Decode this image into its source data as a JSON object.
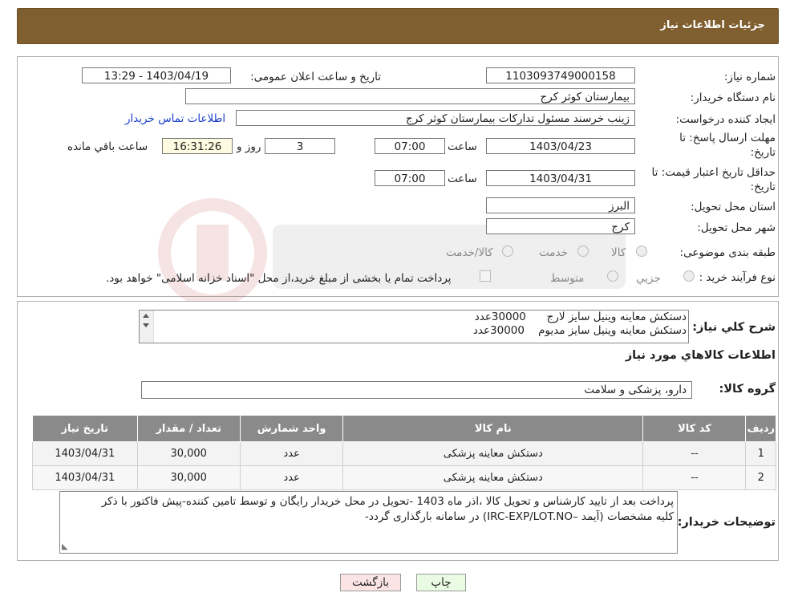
{
  "header": {
    "title": "جزئیات اطلاعات نیاز"
  },
  "form": {
    "need_number_label": "شماره نیاز:",
    "need_number": "1103093749000158",
    "announce_label": "تاریخ و ساعت اعلان عمومی:",
    "announce_value": "1403/04/19 - 13:29",
    "buyer_org_label": "نام دستگاه خریدار:",
    "buyer_org": "بیمارستان کوثر کرج",
    "creator_label": "ایجاد کننده درخواست:",
    "creator": "زینب خرسند مسئول تدارکات بیمارستان کوثر کرج",
    "contact_link": "اطلاعات تماس خریدار",
    "deadline_label_1": "مهلت ارسال پاسخ: تا",
    "deadline_label_2": "تاریخ:",
    "deadline_date": "1403/04/23",
    "time_word": "ساعت",
    "deadline_time": "07:00",
    "days_value": "3",
    "day_word": "روز و",
    "remaining_time": "16:31:26",
    "remaining_label": "ساعت باقي مانده",
    "validity_label_1": "حداقل تاریخ اعتبار قیمت: تا",
    "validity_label_2": "تاریخ:",
    "validity_date": "1403/04/31",
    "validity_time": "07:00",
    "province_label": "استان محل تحویل:",
    "province": "البرز",
    "city_label": "شهر محل تحویل:",
    "city": "کرج",
    "category_label": "طبقه بندی موضوعی:",
    "category_options": [
      "کالا",
      "خدمت",
      "کالا/خدمت"
    ],
    "purchase_type_label": "نوع فرآیند خرید :",
    "purchase_options": [
      "جزیي",
      "متوسط"
    ],
    "payment_note": "پرداخت تمام یا بخشی از مبلغ خرید،از محل \"اسناد خزانه اسلامی\" خواهد بود."
  },
  "summary": {
    "label": "شرح کلي نیاز:",
    "lines": [
      "دستکش معاینه وینیل سایز لارج      30000عدد",
      "دستکش معاینه وینیل سایز مدیوم    30000عدد"
    ]
  },
  "goods": {
    "section_title": "اطلاعات کالاهاي مورد نیاز",
    "group_label": "گروه کالا:",
    "group_value": "دارو، پزشکی و سلامت",
    "columns": [
      "ردیف",
      "کد کالا",
      "نام کالا",
      "واحد شمارش",
      "تعداد / مقدار",
      "تاریخ نیاز"
    ],
    "rows": [
      [
        "1",
        "--",
        "دستکش معاینه پزشکی",
        "عدد",
        "30,000",
        "1403/04/31"
      ],
      [
        "2",
        "--",
        "دستکش معاینه پزشکی",
        "عدد",
        "30,000",
        "1403/04/31"
      ]
    ]
  },
  "notes": {
    "label": "توضیحات خریدار:",
    "line1": "پرداخت بعد از تایید کارشناس و تحویل کالا ،اذر ماه 1403 -تحویل در محل خریدار رایگان و توسط تامین کننده-پیش فاکتور با ذکر",
    "line2": "کلیه مشخصات (آیمد –IRC-EXP/LOT.NO) در سامانه بارگذاری گردد-"
  },
  "buttons": {
    "print": "چاپ",
    "back": "بازگشت"
  },
  "colors": {
    "header_bg": "#7f5f2f",
    "link": "#1a3fd0",
    "back_button": "#fbe4e4",
    "print_button": "#eafbe4"
  }
}
